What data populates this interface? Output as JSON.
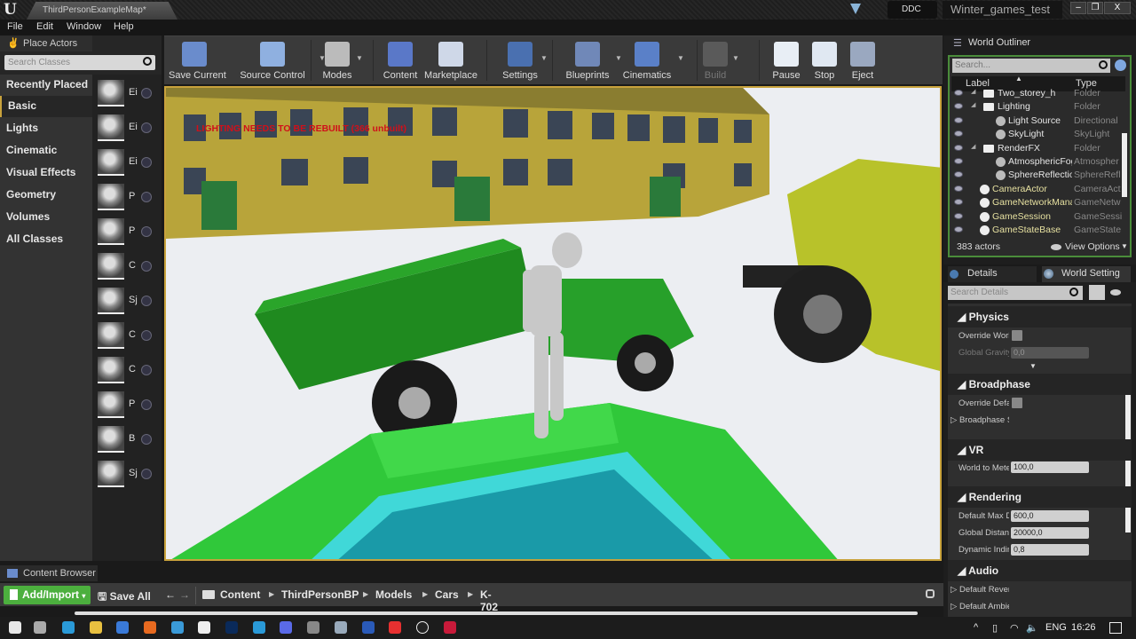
{
  "window": {
    "tab": "ThirdPersonExampleMap*",
    "ddc": "DDC",
    "project": "Winter_games_test",
    "minimize": "–",
    "restore": "❐",
    "close": "X"
  },
  "menu": [
    "File",
    "Edit",
    "Window",
    "Help"
  ],
  "place_actors": {
    "tab": "Place Actors",
    "search_placeholder": "Search Classes",
    "categories": [
      "Recently Placed",
      "Basic",
      "Lights",
      "Cinematic",
      "Visual Effects",
      "Geometry",
      "Volumes",
      "All Classes"
    ],
    "selected": "Basic",
    "items": [
      "Ei",
      "Ei",
      "Ei",
      "P",
      "P",
      "C",
      "Sj",
      "C",
      "C",
      "P",
      "B",
      "Sj"
    ]
  },
  "toolbar": [
    {
      "label": "Save Current",
      "icon": "save-icon",
      "color": "#6a8ccc"
    },
    {
      "label": "Source Control",
      "icon": "source-control-icon",
      "color": "#8fb0e0"
    },
    {
      "label": "Modes",
      "icon": "modes-icon",
      "color": "#bbbbbb"
    },
    {
      "label": "Content",
      "icon": "content-icon",
      "color": "#5a78c8"
    },
    {
      "label": "Marketplace",
      "icon": "marketplace-icon",
      "color": "#cfd8e8"
    },
    {
      "label": "Settings",
      "icon": "settings-icon",
      "color": "#4a70b0"
    },
    {
      "label": "Blueprints",
      "icon": "blueprints-icon",
      "color": "#7088b8"
    },
    {
      "label": "Cinematics",
      "icon": "cinematics-icon",
      "color": "#5a80c8"
    },
    {
      "label": "Build",
      "icon": "build-icon",
      "color": "#5a5a5a"
    },
    {
      "label": "Pause",
      "icon": "pause-icon",
      "color": "#e8eef5"
    },
    {
      "label": "Stop",
      "icon": "stop-icon",
      "color": "#e0e8f2"
    },
    {
      "label": "Eject",
      "icon": "eject-icon",
      "color": "#9aa8c0"
    }
  ],
  "viewport": {
    "warning": "LIGHTING NEEDS TO BE REBUILT (366 unbuilt)"
  },
  "outliner": {
    "tab": "World Outliner",
    "search_placeholder": "Search...",
    "col_label": "Label",
    "col_type": "Type",
    "rows": [
      {
        "label": "Two_storey_h",
        "type": "Folder",
        "kind": "folder",
        "indent": 1
      },
      {
        "label": "Lighting",
        "type": "Folder",
        "kind": "folder",
        "indent": 1
      },
      {
        "label": "Light Source",
        "type": "Directional",
        "kind": "item",
        "indent": 2
      },
      {
        "label": "SkyLight",
        "type": "SkyLight",
        "kind": "item",
        "indent": 2
      },
      {
        "label": "RenderFX",
        "type": "Folder",
        "kind": "folder",
        "indent": 1
      },
      {
        "label": "AtmosphericFog",
        "type": "Atmospher",
        "kind": "item",
        "indent": 2
      },
      {
        "label": "SphereReflection",
        "type": "SphereRefl",
        "kind": "item",
        "indent": 2
      },
      {
        "label": "CameraActor",
        "type": "CameraAct",
        "kind": "actor",
        "indent": 1
      },
      {
        "label": "GameNetworkManager",
        "type": "GameNetw",
        "kind": "actor",
        "indent": 1
      },
      {
        "label": "GameSession",
        "type": "GameSessi",
        "kind": "actor",
        "indent": 1
      },
      {
        "label": "GameStateBase",
        "type": "GameState",
        "kind": "actor",
        "indent": 1
      }
    ],
    "count": "383 actors",
    "view_options": "View Options"
  },
  "details": {
    "tab_details": "Details",
    "tab_world": "World Setting",
    "search_placeholder": "Search Details",
    "sections": {
      "physics": "Physics",
      "broadphase": "Broadphase",
      "vr": "VR",
      "rendering": "Rendering",
      "audio": "Audio"
    },
    "props": {
      "override_world": "Override World",
      "global_gravity": "Global Gravity",
      "global_gravity_val": "0,0",
      "override_default": "Override Default",
      "broadphase_settings": "Broadphase Settings",
      "world_to_meters": "World to Meters",
      "world_to_meters_val": "100,0",
      "default_max": "Default Max Distance",
      "default_max_val": "600,0",
      "global_distance": "Global Distance",
      "global_distance_val": "20000,0",
      "dynamic_indirect": "Dynamic Indirect",
      "dynamic_indirect_val": "0,8",
      "default_reverb": "Default Reverb",
      "default_ambient": "Default Ambient"
    }
  },
  "content_browser": {
    "tab": "Content Browser",
    "add_import": "Add/Import",
    "save_all": "Save All",
    "path": [
      "Content",
      "ThirdPersonBP",
      "Models",
      "Cars",
      "K-702"
    ]
  },
  "taskbar": {
    "lang": "ENG",
    "time": "16:26"
  }
}
